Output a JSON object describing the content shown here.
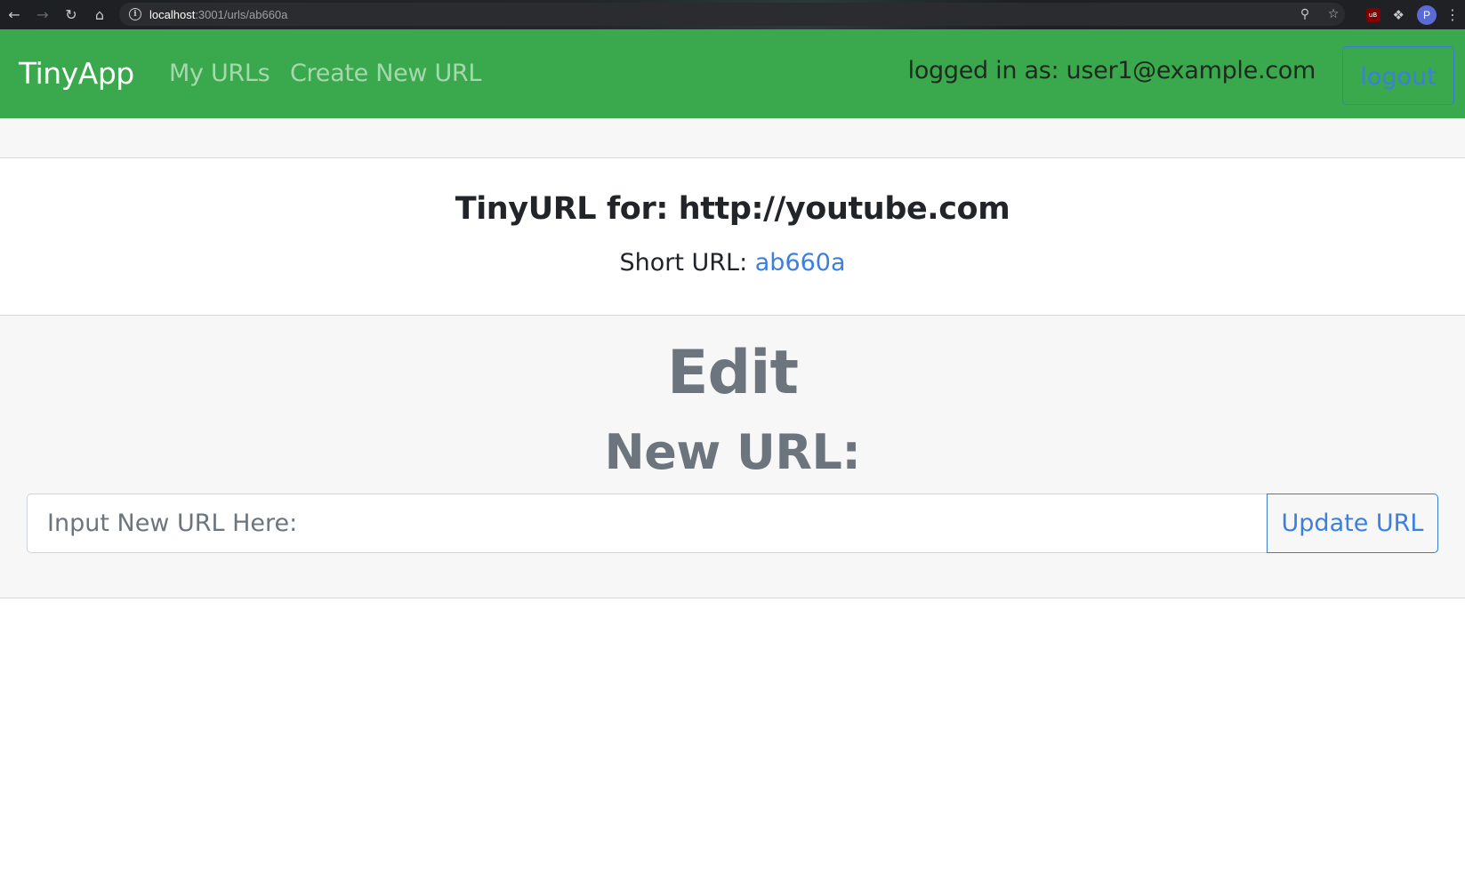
{
  "browser": {
    "url_host": "localhost",
    "url_path": ":3001/urls/ab660a",
    "avatar_initial": "P",
    "ext_ublock_label": "uB"
  },
  "navbar": {
    "brand": "TinyApp",
    "links": [
      {
        "label": "My URLs"
      },
      {
        "label": "Create New URL"
      }
    ],
    "logged_in_text": "logged in as: user1@example.com",
    "logout_label": "logout",
    "bg_color": "#3aa84c"
  },
  "info": {
    "title": "TinyURL for: http://youtube.com",
    "short_label": "Short URL: ",
    "short_value": "ab660a"
  },
  "edit": {
    "heading": "Edit",
    "subheading": "New URL:",
    "input_placeholder": "Input New URL Here:",
    "input_value": "",
    "submit_label": "Update URL"
  }
}
